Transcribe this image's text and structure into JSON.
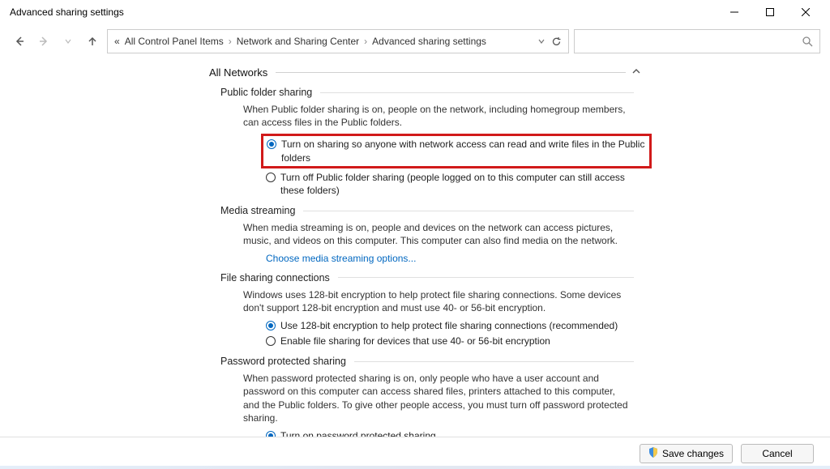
{
  "window": {
    "title": "Advanced sharing settings"
  },
  "breadcrumb": {
    "prefix": "«",
    "item1": "All Control Panel Items",
    "item2": "Network and Sharing Center",
    "item3": "Advanced sharing settings"
  },
  "section": {
    "title": "All Networks"
  },
  "public_folder": {
    "heading": "Public folder sharing",
    "desc": "When Public folder sharing is on, people on the network, including homegroup members, can access files in the Public folders.",
    "opt_on": "Turn on sharing so anyone with network access can read and write files in the Public folders",
    "opt_off": "Turn off Public folder sharing (people logged on to this computer can still access these folders)",
    "selected": "on"
  },
  "media": {
    "heading": "Media streaming",
    "desc": "When media streaming is on, people and devices on the network can access pictures, music, and videos on this computer. This computer can also find media on the network.",
    "link": "Choose media streaming options..."
  },
  "file_sharing": {
    "heading": "File sharing connections",
    "desc": "Windows uses 128-bit encryption to help protect file sharing connections. Some devices don't support 128-bit encryption and must use 40- or 56-bit encryption.",
    "opt_128": "Use 128-bit encryption to help protect file sharing connections (recommended)",
    "opt_4056": "Enable file sharing for devices that use 40- or 56-bit encryption",
    "selected": "128"
  },
  "password": {
    "heading": "Password protected sharing",
    "desc": "When password protected sharing is on, only people who have a user account and password on this computer can access shared files, printers attached to this computer, and the Public folders. To give other people access, you must turn off password protected sharing.",
    "opt_on": "Turn on password protected sharing",
    "selected": "on"
  },
  "buttons": {
    "save": "Save changes",
    "cancel": "Cancel"
  }
}
